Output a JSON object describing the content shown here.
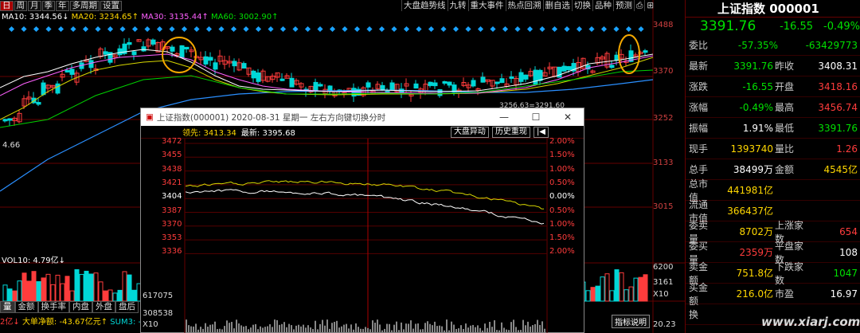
{
  "toolbar": {
    "periods": [
      "日",
      "周",
      "月",
      "季",
      "年",
      "多周期",
      "设置"
    ],
    "active_period": "日"
  },
  "tools": [
    "大盘趋势线",
    "九转",
    "重大事件",
    "热点回溯",
    "删自选",
    "切换",
    "品种",
    "预测",
    "⎙",
    "⊞"
  ],
  "ma": {
    "ma10": "MA10: 3344.56↓",
    "ma20": "MA20: 3234.65↑",
    "ma30": "MA30: 3135.44↑",
    "ma60": "MA60: 3002.90↑"
  },
  "axis_labels": [
    "3488",
    "3370",
    "3252",
    "3133",
    "3015"
  ],
  "vol_axis": [
    "6200",
    "3161",
    "X10"
  ],
  "low_label": "4.66",
  "vol_label": "VOL10: 4.79亿↓",
  "bottom_tabs": [
    "量",
    "金额",
    "换手率",
    "内盘",
    "外盘",
    "盘后"
  ],
  "bottom_info": {
    "a": "2亿↓",
    "b": "大单净额: -43.67亿元↑",
    "c": "SUM3: -"
  },
  "index_name": "上证指数 000001",
  "price": "3391.76",
  "change": "-16.55",
  "pct": "-0.49%",
  "weibi": {
    "label": "委比",
    "pct": "-57.35%",
    "diff": "-63429773"
  },
  "rows": [
    {
      "l1": "最新",
      "v1": "3391.76",
      "c1": "green",
      "l2": "昨收",
      "v2": "3408.31",
      "c2": "white"
    },
    {
      "l1": "涨跌",
      "v1": "-16.55",
      "c1": "green",
      "l2": "开盘",
      "v2": "3418.16",
      "c2": "red"
    },
    {
      "l1": "涨幅",
      "v1": "-0.49%",
      "c1": "green",
      "l2": "最高",
      "v2": "3456.74",
      "c2": "red"
    },
    {
      "l1": "振幅",
      "v1": "1.91%",
      "c1": "white",
      "l2": "最低",
      "v2": "3391.76",
      "c2": "green"
    },
    {
      "l1": "现手",
      "v1": "1393740",
      "c1": "yellow",
      "l2": "量比",
      "v2": "1.26",
      "c2": "red"
    },
    {
      "l1": "总手",
      "v1": "38499万",
      "c1": "white",
      "l2": "金额",
      "v2": "4545亿",
      "c2": "yellow"
    },
    {
      "l1": "总市值",
      "v1": "441981亿",
      "c1": "yellow",
      "l2": "",
      "v2": "",
      "c2": "white"
    },
    {
      "l1": "流通市值",
      "v1": "366437亿",
      "c1": "yellow",
      "l2": "",
      "v2": "",
      "c2": "white"
    },
    {
      "l1": "委卖量",
      "v1": "8702万",
      "c1": "yellow",
      "l2": "上涨家数",
      "v2": "654",
      "c2": "red"
    },
    {
      "l1": "委买量",
      "v1": "2359万",
      "c1": "red",
      "l2": "平盘家数",
      "v2": "108",
      "c2": "white"
    },
    {
      "l1": "卖金额",
      "v1": "751.8亿",
      "c1": "yellow",
      "l2": "下跌家数",
      "v2": "1047",
      "c2": "green"
    },
    {
      "l1": "买金额",
      "v1": "216.0亿",
      "c1": "yellow",
      "l2": "市盈",
      "v2": "16.97",
      "c2": "white"
    },
    {
      "l1": "换",
      "v1": "",
      "c1": "white",
      "l2": "",
      "v2": "",
      "c2": "white"
    }
  ],
  "watermark": "www.xiarj.com",
  "popup": {
    "title": "上证指数(000001) 2020-08-31 星期一    左右方向键切换分时",
    "lead": "领先: 3413.34",
    "latest": "最新: 3395.68",
    "btn1": "大盘异动",
    "btn2": "历史重现",
    "left_axis": [
      "3472",
      "3455",
      "3438",
      "3421",
      "3404",
      "3387",
      "3370",
      "3353",
      "3336"
    ],
    "right_axis": [
      "2.00%",
      "1.50%",
      "1.00%",
      "0.50%",
      "0.00%",
      "0.50%",
      "1.00%",
      "1.50%",
      "2.00%"
    ],
    "vol_axis": [
      "617075",
      "308538",
      "X10"
    ],
    "hint": "3256.63=3291.60",
    "btn3": "指标说明"
  }
}
